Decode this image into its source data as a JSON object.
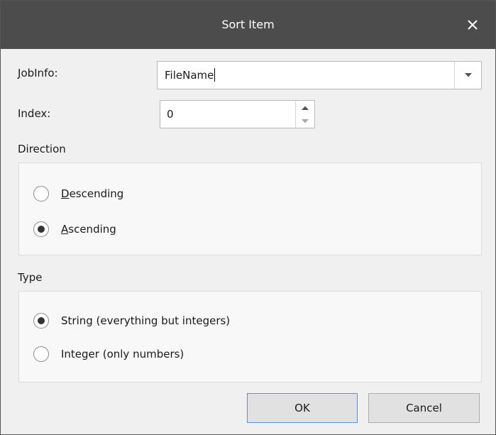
{
  "dialog": {
    "title": "Sort Item",
    "close_icon": "close-icon"
  },
  "jobinfo": {
    "label_mnemonic": "J",
    "label_rest": "obInfo:",
    "value": "FileName",
    "dropdown_icon": "chevron-down-icon"
  },
  "index": {
    "label": "Index:",
    "value": "0",
    "up_icon": "spin-up-icon",
    "down_icon": "spin-down-icon"
  },
  "direction": {
    "label": "Direction",
    "options": [
      {
        "mnemonic": "D",
        "rest": "escending",
        "checked": false
      },
      {
        "mnemonic": "A",
        "rest": "scending",
        "checked": true
      }
    ]
  },
  "type": {
    "label": "Type",
    "options": [
      {
        "label": "String (everything but integers)",
        "checked": true
      },
      {
        "label": "Integer (only numbers)",
        "checked": false
      }
    ]
  },
  "buttons": {
    "ok_label": "OK",
    "cancel_label": "Cancel"
  },
  "colors": {
    "titlebar": "#4c4c4c",
    "panel": "#f8f8f8",
    "button": "#e1e1e1",
    "default_button_border": "#5b8dd9"
  }
}
